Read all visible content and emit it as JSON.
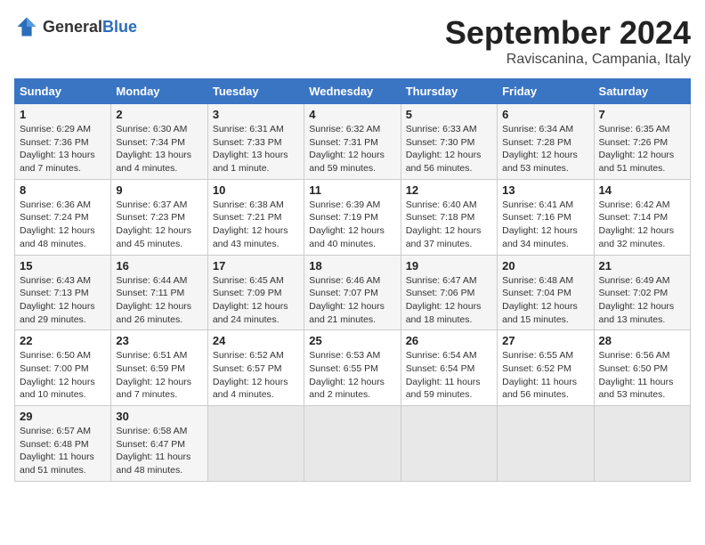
{
  "header": {
    "logo_general": "General",
    "logo_blue": "Blue",
    "month_title": "September 2024",
    "location": "Raviscanina, Campania, Italy"
  },
  "weekdays": [
    "Sunday",
    "Monday",
    "Tuesday",
    "Wednesday",
    "Thursday",
    "Friday",
    "Saturday"
  ],
  "weeks": [
    [
      {
        "day": "1",
        "info": "Sunrise: 6:29 AM\nSunset: 7:36 PM\nDaylight: 13 hours and 7 minutes."
      },
      {
        "day": "2",
        "info": "Sunrise: 6:30 AM\nSunset: 7:34 PM\nDaylight: 13 hours and 4 minutes."
      },
      {
        "day": "3",
        "info": "Sunrise: 6:31 AM\nSunset: 7:33 PM\nDaylight: 13 hours and 1 minute."
      },
      {
        "day": "4",
        "info": "Sunrise: 6:32 AM\nSunset: 7:31 PM\nDaylight: 12 hours and 59 minutes."
      },
      {
        "day": "5",
        "info": "Sunrise: 6:33 AM\nSunset: 7:30 PM\nDaylight: 12 hours and 56 minutes."
      },
      {
        "day": "6",
        "info": "Sunrise: 6:34 AM\nSunset: 7:28 PM\nDaylight: 12 hours and 53 minutes."
      },
      {
        "day": "7",
        "info": "Sunrise: 6:35 AM\nSunset: 7:26 PM\nDaylight: 12 hours and 51 minutes."
      }
    ],
    [
      {
        "day": "8",
        "info": "Sunrise: 6:36 AM\nSunset: 7:24 PM\nDaylight: 12 hours and 48 minutes."
      },
      {
        "day": "9",
        "info": "Sunrise: 6:37 AM\nSunset: 7:23 PM\nDaylight: 12 hours and 45 minutes."
      },
      {
        "day": "10",
        "info": "Sunrise: 6:38 AM\nSunset: 7:21 PM\nDaylight: 12 hours and 43 minutes."
      },
      {
        "day": "11",
        "info": "Sunrise: 6:39 AM\nSunset: 7:19 PM\nDaylight: 12 hours and 40 minutes."
      },
      {
        "day": "12",
        "info": "Sunrise: 6:40 AM\nSunset: 7:18 PM\nDaylight: 12 hours and 37 minutes."
      },
      {
        "day": "13",
        "info": "Sunrise: 6:41 AM\nSunset: 7:16 PM\nDaylight: 12 hours and 34 minutes."
      },
      {
        "day": "14",
        "info": "Sunrise: 6:42 AM\nSunset: 7:14 PM\nDaylight: 12 hours and 32 minutes."
      }
    ],
    [
      {
        "day": "15",
        "info": "Sunrise: 6:43 AM\nSunset: 7:13 PM\nDaylight: 12 hours and 29 minutes."
      },
      {
        "day": "16",
        "info": "Sunrise: 6:44 AM\nSunset: 7:11 PM\nDaylight: 12 hours and 26 minutes."
      },
      {
        "day": "17",
        "info": "Sunrise: 6:45 AM\nSunset: 7:09 PM\nDaylight: 12 hours and 24 minutes."
      },
      {
        "day": "18",
        "info": "Sunrise: 6:46 AM\nSunset: 7:07 PM\nDaylight: 12 hours and 21 minutes."
      },
      {
        "day": "19",
        "info": "Sunrise: 6:47 AM\nSunset: 7:06 PM\nDaylight: 12 hours and 18 minutes."
      },
      {
        "day": "20",
        "info": "Sunrise: 6:48 AM\nSunset: 7:04 PM\nDaylight: 12 hours and 15 minutes."
      },
      {
        "day": "21",
        "info": "Sunrise: 6:49 AM\nSunset: 7:02 PM\nDaylight: 12 hours and 13 minutes."
      }
    ],
    [
      {
        "day": "22",
        "info": "Sunrise: 6:50 AM\nSunset: 7:00 PM\nDaylight: 12 hours and 10 minutes."
      },
      {
        "day": "23",
        "info": "Sunrise: 6:51 AM\nSunset: 6:59 PM\nDaylight: 12 hours and 7 minutes."
      },
      {
        "day": "24",
        "info": "Sunrise: 6:52 AM\nSunset: 6:57 PM\nDaylight: 12 hours and 4 minutes."
      },
      {
        "day": "25",
        "info": "Sunrise: 6:53 AM\nSunset: 6:55 PM\nDaylight: 12 hours and 2 minutes."
      },
      {
        "day": "26",
        "info": "Sunrise: 6:54 AM\nSunset: 6:54 PM\nDaylight: 11 hours and 59 minutes."
      },
      {
        "day": "27",
        "info": "Sunrise: 6:55 AM\nSunset: 6:52 PM\nDaylight: 11 hours and 56 minutes."
      },
      {
        "day": "28",
        "info": "Sunrise: 6:56 AM\nSunset: 6:50 PM\nDaylight: 11 hours and 53 minutes."
      }
    ],
    [
      {
        "day": "29",
        "info": "Sunrise: 6:57 AM\nSunset: 6:48 PM\nDaylight: 11 hours and 51 minutes."
      },
      {
        "day": "30",
        "info": "Sunrise: 6:58 AM\nSunset: 6:47 PM\nDaylight: 11 hours and 48 minutes."
      },
      {
        "day": "",
        "info": ""
      },
      {
        "day": "",
        "info": ""
      },
      {
        "day": "",
        "info": ""
      },
      {
        "day": "",
        "info": ""
      },
      {
        "day": "",
        "info": ""
      }
    ]
  ]
}
